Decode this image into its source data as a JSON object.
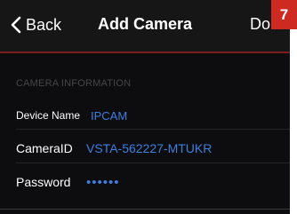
{
  "nav": {
    "back_label": "Back",
    "title": "Add Camera",
    "done_label": "Done"
  },
  "step_badge": "7",
  "section": {
    "header": "CAMERA INFORMATION"
  },
  "fields": [
    {
      "label": "Device Name",
      "value": "IPCAM"
    },
    {
      "label": "CameraID",
      "value": "VSTA-562227-MTUKR"
    },
    {
      "label": "Password",
      "value": "••••••"
    }
  ],
  "colors": {
    "background": "#0d0d0f",
    "value_text": "#3d7fe0",
    "badge": "#cf2a22",
    "nav_divider": "#7a1d1d"
  },
  "icons": {
    "back": "chevron-left-icon"
  }
}
